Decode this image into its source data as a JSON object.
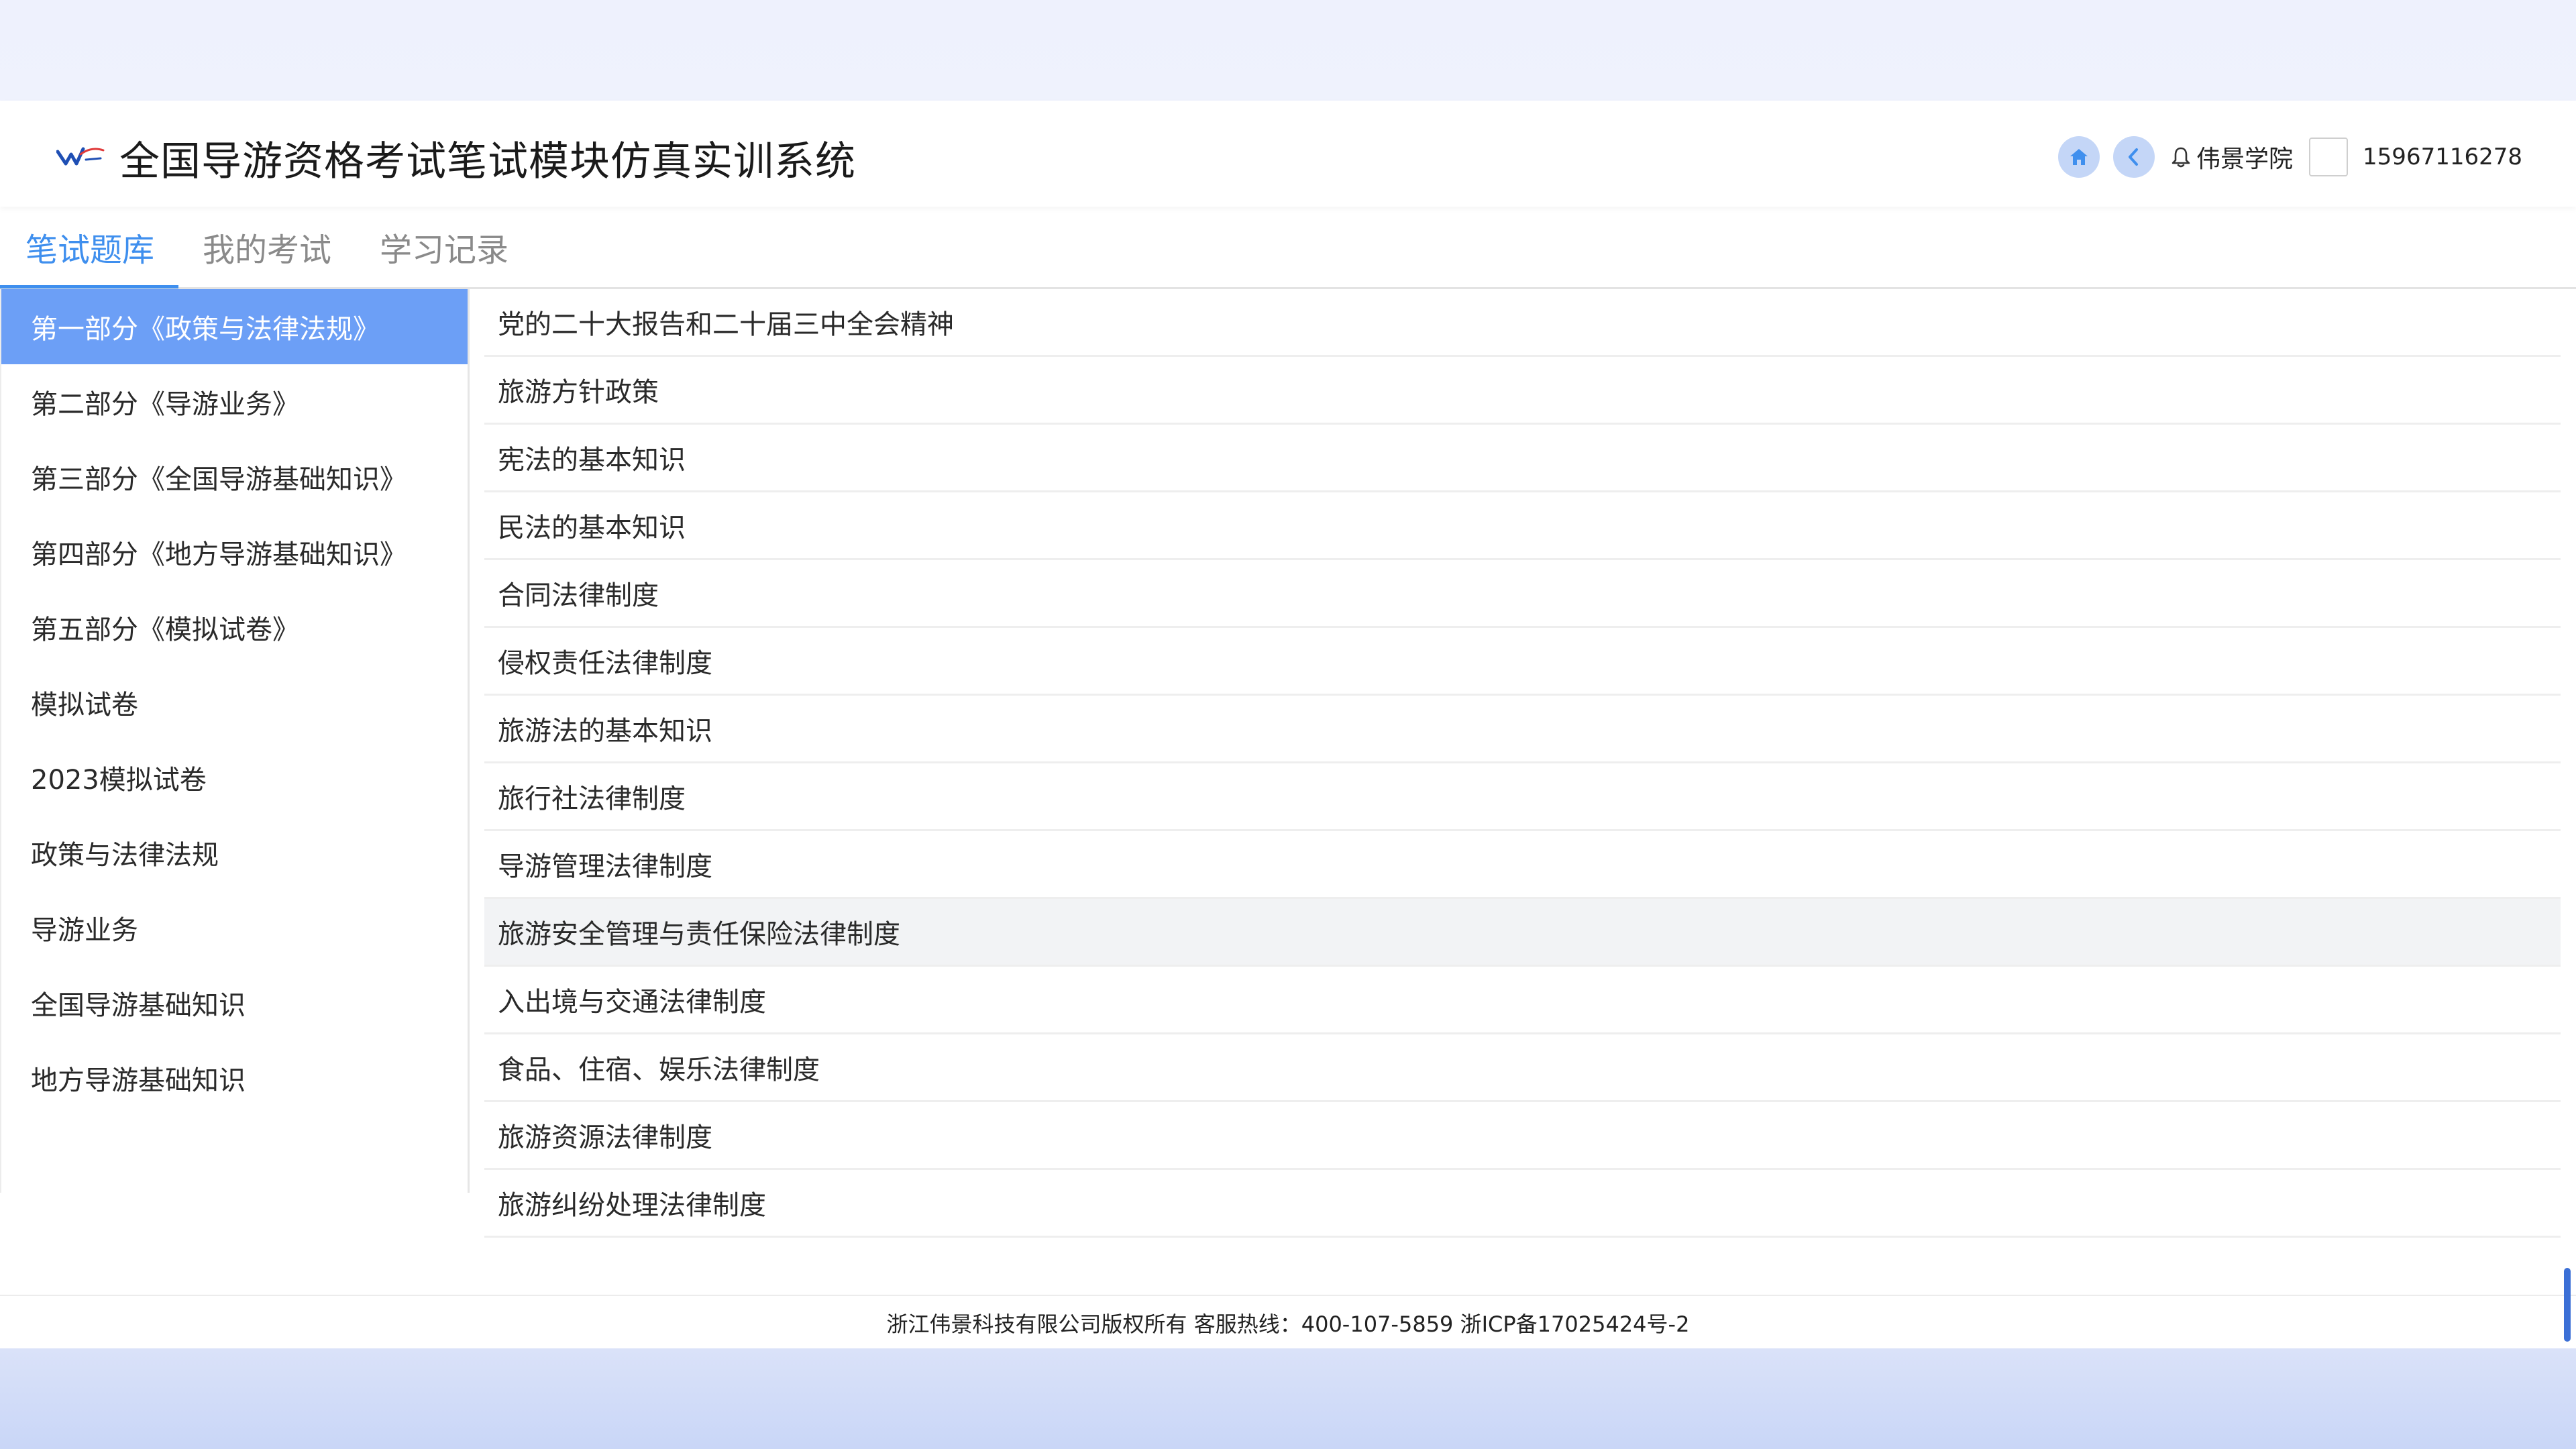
{
  "header": {
    "title": "全国导游资格考试笔试模块仿真实训系统",
    "org_name": "伟景学院",
    "phone": "15967116278",
    "icons": [
      "logo",
      "home-icon",
      "back-icon",
      "bell-icon"
    ]
  },
  "tabs": [
    {
      "label": "笔试题库",
      "active": true
    },
    {
      "label": "我的考试",
      "active": false
    },
    {
      "label": "学习记录",
      "active": false
    }
  ],
  "sidebar": {
    "items": [
      {
        "label": "第一部分《政策与法律法规》",
        "active": true
      },
      {
        "label": "第二部分《导游业务》"
      },
      {
        "label": "第三部分《全国导游基础知识》"
      },
      {
        "label": "第四部分《地方导游基础知识》"
      },
      {
        "label": "第五部分《模拟试卷》"
      },
      {
        "label": "模拟试卷"
      },
      {
        "label": "2023模拟试卷"
      },
      {
        "label": "政策与法律法规"
      },
      {
        "label": "导游业务"
      },
      {
        "label": "全国导游基础知识"
      },
      {
        "label": "地方导游基础知识"
      }
    ]
  },
  "topics": [
    "党的二十大报告和二十届三中全会精神",
    "旅游方针政策",
    "宪法的基本知识",
    "民法的基本知识",
    "合同法律制度",
    "侵权责任法律制度",
    "旅游法的基本知识",
    "旅行社法律制度",
    "导游管理法律制度",
    "旅游安全管理与责任保险法律制度",
    "入出境与交通法律制度",
    "食品、住宿、娱乐法律制度",
    "旅游资源法律制度",
    "旅游纠纷处理法律制度"
  ],
  "footer": {
    "text": "浙江伟景科技有限公司版权所有 客服热线：400-107-5859 浙ICP备17025424号-2"
  },
  "colors": {
    "accent": "#3f8fee",
    "sidebar_active": "#6c9ff6",
    "round_button": "#c4d6f7"
  }
}
